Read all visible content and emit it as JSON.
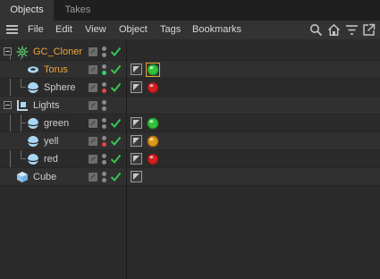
{
  "tabs": [
    {
      "label": "Objects",
      "active": true
    },
    {
      "label": "Takes",
      "active": false
    }
  ],
  "menu": {
    "items": [
      "File",
      "Edit",
      "View",
      "Object",
      "Tags",
      "Bookmarks"
    ],
    "tools": [
      "search-icon",
      "home-icon",
      "filter-icon",
      "new-window-icon"
    ]
  },
  "colors": {
    "selected_text": "#f1a53a",
    "check_green": "#38c454",
    "dot_green": "#37d06a",
    "dot_red": "#e0474c"
  },
  "objects": [
    {
      "name": "GC_Cloner",
      "icon": "cloner-icon",
      "level": 0,
      "expanded": true,
      "dot_top": "grey",
      "dot_bottom": "grey",
      "tags": []
    },
    {
      "name": "Torus",
      "icon": "torus-icon",
      "level": 1,
      "selected": true,
      "dot_top": "grey",
      "dot_bottom": "green",
      "tags": [
        "flag",
        "green-material"
      ]
    },
    {
      "name": "Sphere",
      "icon": "sphere-icon",
      "level": 1,
      "dot_top": "grey",
      "dot_bottom": "red",
      "tags": [
        "flag",
        "red-material"
      ]
    },
    {
      "name": "Lights",
      "icon": "null-group-icon",
      "level": 0,
      "expanded": true,
      "dot_top": "grey",
      "dot_bottom": "grey",
      "tags": []
    },
    {
      "name": "green",
      "icon": "sphere-icon",
      "level": 1,
      "dot_top": "grey",
      "dot_bottom": "grey",
      "tags": [
        "flag",
        "green-material"
      ]
    },
    {
      "name": "yell",
      "icon": "sphere-icon",
      "level": 1,
      "dot_top": "grey",
      "dot_bottom": "red",
      "tags": [
        "flag",
        "yellow-material"
      ]
    },
    {
      "name": "red",
      "icon": "sphere-icon",
      "level": 1,
      "dot_top": "grey",
      "dot_bottom": "grey",
      "tags": [
        "flag",
        "red-material"
      ]
    },
    {
      "name": "Cube",
      "icon": "cube-icon",
      "level": 0,
      "dot_top": "grey",
      "dot_bottom": "grey",
      "tags": [
        "flag"
      ]
    }
  ]
}
